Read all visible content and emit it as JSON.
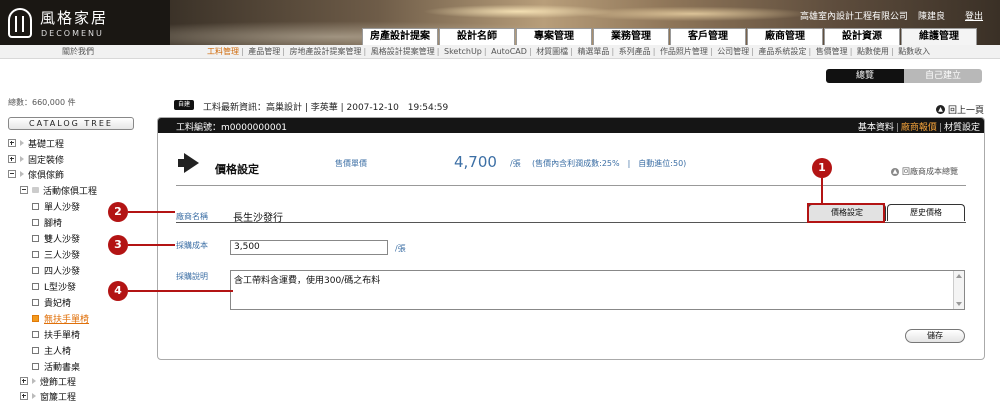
{
  "header": {
    "logo_cn": "風格家居",
    "logo_en": "DECOMENU",
    "company": "高雄室內設計工程有限公司",
    "user": "陳建良",
    "logout": "登出",
    "tabs": [
      "房產設計提案",
      "設計名師",
      "專案管理",
      "業務管理",
      "客戶管理",
      "廠商管理",
      "設計資源",
      "維護管理"
    ],
    "active_tab": "維護管理"
  },
  "subnav": {
    "about": "關於我們",
    "items": [
      "工料管理",
      "產品管理",
      "房地產設計提案管理",
      "風格設計提案管理",
      "SketchUp",
      "AutoCAD",
      "材質圖檔",
      "精選單品",
      "系列產品",
      "作品照片管理",
      "公司管理",
      "產品系統設定",
      "售價管理",
      "點數使用",
      "點數收入"
    ],
    "active": "工料管理"
  },
  "view_toggle": {
    "browse": "總覽",
    "self_build": "自己建立"
  },
  "sidebar": {
    "total": "總數：660,000 件",
    "catalog_button": "CATALOG TREE",
    "tree": [
      {
        "label": "基礎工程"
      },
      {
        "label": "固定裝修"
      },
      {
        "label": "傢俱傢飾"
      },
      {
        "label": "活動傢俱工程"
      },
      {
        "label": "單人沙發"
      },
      {
        "label": "腳椅"
      },
      {
        "label": "雙人沙發"
      },
      {
        "label": "三人沙發"
      },
      {
        "label": "四人沙發"
      },
      {
        "label": "L型沙發"
      },
      {
        "label": "貴妃椅"
      },
      {
        "label": "無扶手單椅"
      },
      {
        "label": "扶手單椅"
      },
      {
        "label": "主人椅"
      },
      {
        "label": "活動書桌"
      },
      {
        "label": "燈飾工程"
      },
      {
        "label": "窗簾工程"
      }
    ]
  },
  "info": {
    "tag": "自建",
    "text": "工料最新資訊：高巢設計 | 李英華 | 2007-12-10　19:54:59",
    "back": "回上一頁"
  },
  "panel": {
    "sku": "工料編號：m0000000001",
    "links": [
      "基本資料",
      "廠商報價",
      "材質設定"
    ],
    "active_link": "廠商報價",
    "title": "價格設定",
    "sale_label": "售價單價",
    "sale_price": "4,700",
    "sale_unit": "/張",
    "sale_note": "(售價內含利潤成數:25%　|　自動進位:50)",
    "return_link": "回廠商成本總覽",
    "tabs": [
      "價格設定",
      "歷史價格"
    ],
    "active_tab": "價格設定",
    "vendor_label": "廠商名稱",
    "vendor_value": "長生沙發行",
    "cost_label": "採購成本",
    "cost_value": "3,500",
    "cost_unit": "/張",
    "desc_label": "採購說明",
    "desc_value": "含工帶料含運費，使用300/碼之布料",
    "save": "儲存"
  },
  "annotations": [
    "1",
    "2",
    "3",
    "4"
  ],
  "colors": {
    "accent": "#e0700a",
    "label_blue": "#3c6fa5",
    "callout": "#b31414",
    "header_dark": "#151515"
  }
}
